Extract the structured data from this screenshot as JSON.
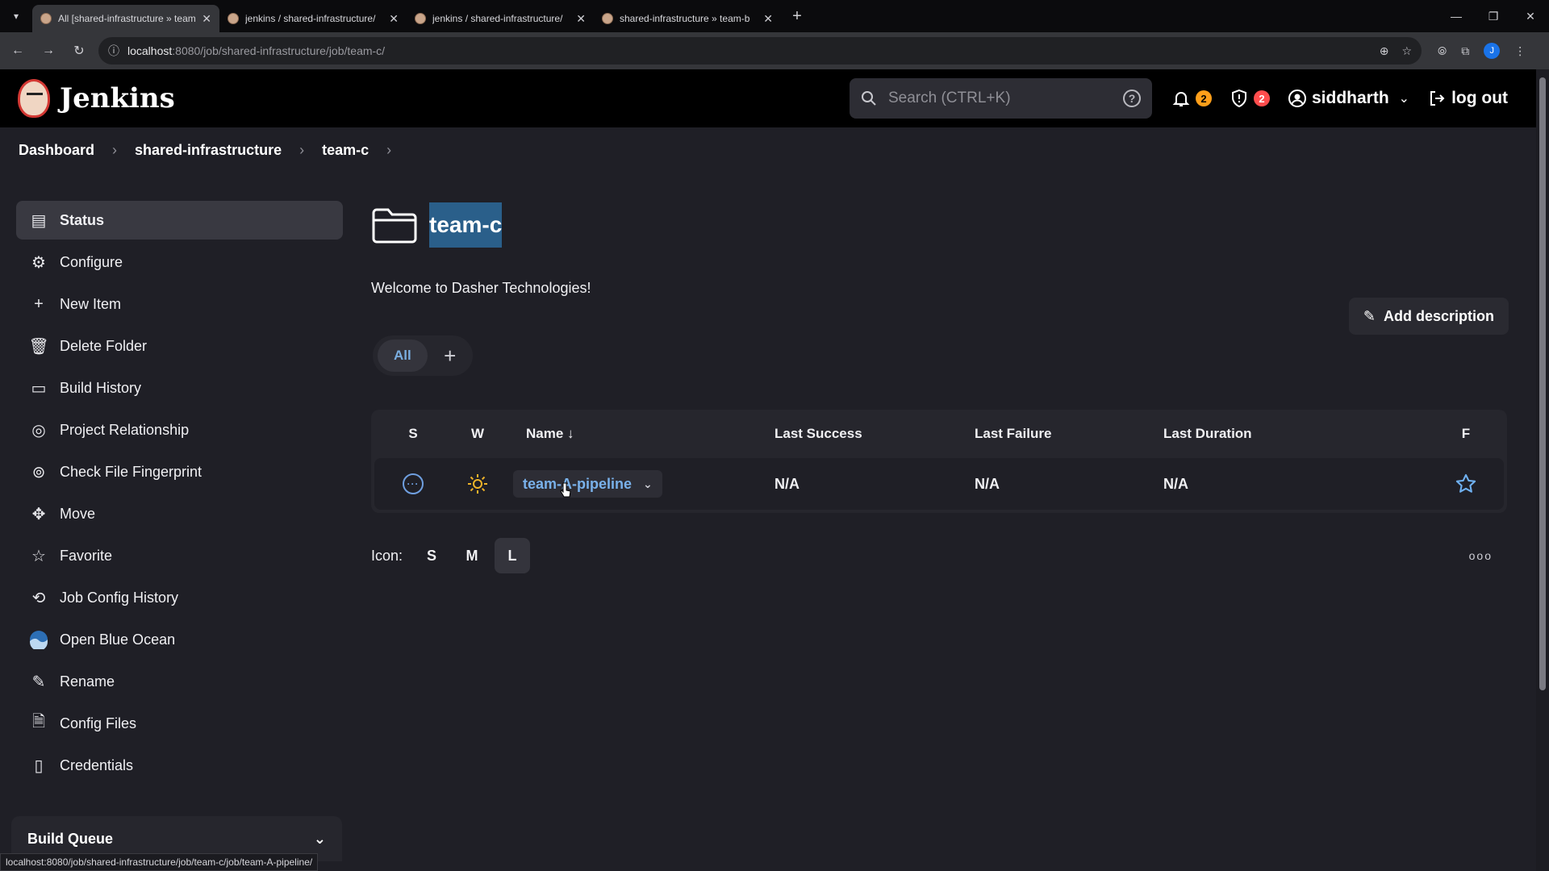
{
  "browser": {
    "tabs": [
      {
        "title": "All [shared-infrastructure » team-c]",
        "active": true
      },
      {
        "title": "jenkins / shared-infrastructure/",
        "active": false
      },
      {
        "title": "jenkins / shared-infrastructure/",
        "active": false
      },
      {
        "title": "shared-infrastructure » team-b",
        "active": false
      }
    ],
    "url_host": "localhost",
    "url_path": ":8080/job/shared-infrastructure/job/team-c/",
    "profile_initial": "J",
    "status_url": "localhost:8080/job/shared-infrastructure/job/team-c/job/team-A-pipeline/"
  },
  "header": {
    "brand": "Jenkins",
    "search_placeholder": "Search (CTRL+K)",
    "notifications_count": "2",
    "security_count": "2",
    "user": "siddharth",
    "logout": "log out",
    "colors": {
      "notify": "#ff9f1a",
      "security": "#ff4d4d"
    }
  },
  "breadcrumb": [
    "Dashboard",
    "shared-infrastructure",
    "team-c"
  ],
  "sidebar": {
    "items": [
      {
        "label": "Status",
        "icon": "status-icon"
      },
      {
        "label": "Configure",
        "icon": "gear-icon"
      },
      {
        "label": "New Item",
        "icon": "plus-icon"
      },
      {
        "label": "Delete Folder",
        "icon": "trash-icon"
      },
      {
        "label": "Build History",
        "icon": "inbox-icon"
      },
      {
        "label": "Project Relationship",
        "icon": "relationship-icon"
      },
      {
        "label": "Check File Fingerprint",
        "icon": "fingerprint-icon"
      },
      {
        "label": "Move",
        "icon": "move-icon"
      },
      {
        "label": "Favorite",
        "icon": "star-icon"
      },
      {
        "label": "Job Config History",
        "icon": "config-history-icon"
      },
      {
        "label": "Open Blue Ocean",
        "icon": "blue-ocean-icon"
      },
      {
        "label": "Rename",
        "icon": "pencil-icon"
      },
      {
        "label": "Config Files",
        "icon": "file-icon"
      },
      {
        "label": "Credentials",
        "icon": "credentials-icon"
      }
    ],
    "build_queue": "Build Queue"
  },
  "main": {
    "title": "team-c",
    "welcome": "Welcome to Dasher Technologies!",
    "add_description": "Add description",
    "views": [
      "All"
    ],
    "table": {
      "headers": {
        "s": "S",
        "w": "W",
        "name": "Name ↓",
        "last_success": "Last Success",
        "last_failure": "Last Failure",
        "last_duration": "Last Duration",
        "f": "F"
      },
      "rows": [
        {
          "name": "team-A-pipeline",
          "last_success": "N/A",
          "last_failure": "N/A",
          "last_duration": "N/A"
        }
      ]
    },
    "icon_legend": {
      "label": "Icon:",
      "sizes": [
        "S",
        "M",
        "L"
      ],
      "selected": "L"
    }
  }
}
